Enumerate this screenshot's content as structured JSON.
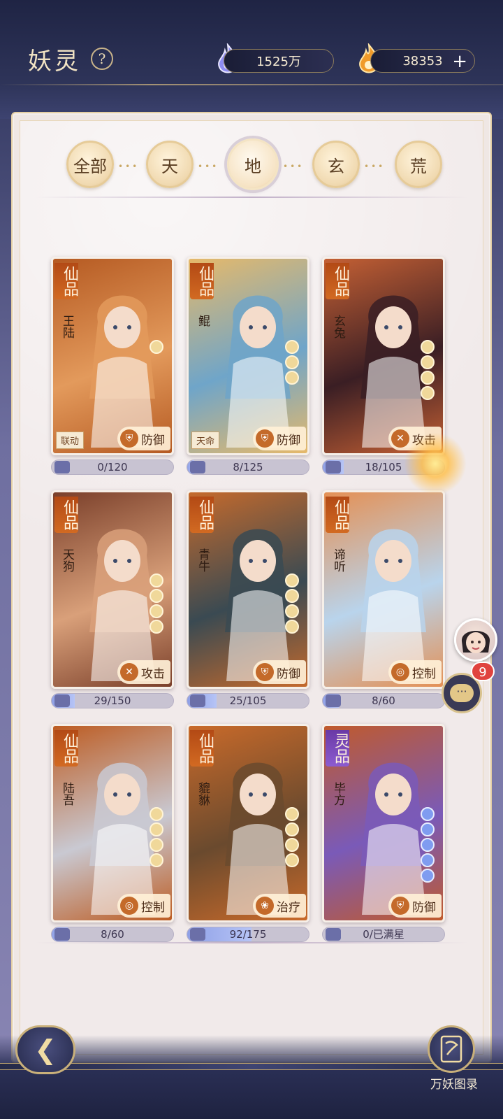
{
  "header": {
    "title": "妖灵",
    "help_symbol": "?",
    "currency_1": {
      "value": "1525万",
      "icon": "blue-flame-icon"
    },
    "currency_2": {
      "value": "38353",
      "icon": "orange-flame-icon",
      "add_symbol": "+"
    }
  },
  "tabs": [
    {
      "label": "全部",
      "active": false
    },
    {
      "label": "天",
      "active": false
    },
    {
      "label": "地",
      "active": true
    },
    {
      "label": "玄",
      "active": false
    },
    {
      "label": "荒",
      "active": false
    }
  ],
  "cards": [
    {
      "grade": "仙品",
      "name": "王陆",
      "badge": "联动",
      "role": "防御",
      "role_icon": "shield-icon",
      "progress": "0/120",
      "fill": 0.0,
      "stars": 1,
      "star_color": "gold",
      "colors": [
        "#e39a5c",
        "#b55a22"
      ]
    },
    {
      "grade": "仙品",
      "name": "鲲",
      "badge": "天命",
      "role": "防御",
      "role_icon": "shield-icon",
      "progress": "8/125",
      "fill": 0.064,
      "stars": 3,
      "star_color": "gold",
      "colors": [
        "#6fa5c9",
        "#e6b96a"
      ]
    },
    {
      "grade": "仙品",
      "name": "玄兔",
      "badge": "",
      "role": "攻击",
      "role_icon": "swords-icon",
      "progress": "18/105",
      "fill": 0.17,
      "stars": 4,
      "star_color": "gold",
      "colors": [
        "#3a1e24",
        "#c46034"
      ]
    },
    {
      "grade": "仙品",
      "name": "天狗",
      "badge": "",
      "role": "攻击",
      "role_icon": "swords-icon",
      "progress": "29/150",
      "fill": 0.19,
      "stars": 4,
      "star_color": "gold",
      "colors": [
        "#d9a07a",
        "#7a3f2a"
      ]
    },
    {
      "grade": "仙品",
      "name": "青牛",
      "badge": "",
      "role": "防御",
      "role_icon": "shield-icon",
      "progress": "25/105",
      "fill": 0.24,
      "stars": 4,
      "star_color": "gold",
      "colors": [
        "#3a4a52",
        "#c56a2c"
      ]
    },
    {
      "grade": "仙品",
      "name": "谛听",
      "badge": "",
      "role": "控制",
      "role_icon": "swirl-icon",
      "progress": "8/60",
      "fill": 0.13,
      "stars": 0,
      "star_color": "gold",
      "colors": [
        "#b9d4ec",
        "#e49054"
      ]
    },
    {
      "grade": "仙品",
      "name": "陆吾",
      "badge": "",
      "role": "控制",
      "role_icon": "swirl-icon",
      "progress": "8/60",
      "fill": 0.13,
      "stars": 4,
      "star_color": "gold",
      "colors": [
        "#c9c9d2",
        "#bd5c22"
      ]
    },
    {
      "grade": "仙品",
      "name": "貔貅",
      "badge": "",
      "role": "治疗",
      "role_icon": "lotus-icon",
      "progress": "92/175",
      "fill": 0.53,
      "stars": 4,
      "star_color": "gold",
      "colors": [
        "#6a4a2e",
        "#c96a2a"
      ]
    },
    {
      "grade": "灵品",
      "name": "毕方",
      "badge": "",
      "role": "防御",
      "role_icon": "shield-icon",
      "progress": "0/已满星",
      "fill": 0.0,
      "stars": 5,
      "star_color": "blue",
      "colors": [
        "#7a5ab8",
        "#c05a2c"
      ]
    }
  ],
  "floating": {
    "chat_count": "9",
    "chat_symbol": "···"
  },
  "footer": {
    "back_symbol": "❮",
    "codex_label": "万妖图录",
    "codex_icon": "book-icon"
  }
}
